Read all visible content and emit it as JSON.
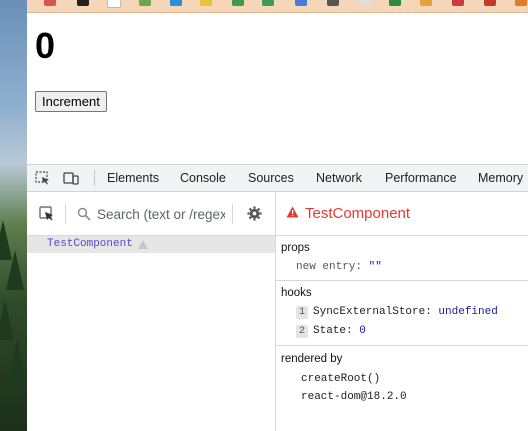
{
  "app": {
    "count": "0",
    "increment_label": "Increment"
  },
  "devtools": {
    "tabs": [
      "Elements",
      "Console",
      "Sources",
      "Network",
      "Performance",
      "Memory"
    ],
    "search": {
      "placeholder": "Search (text or /regex/)"
    },
    "tree": [
      {
        "label": "TestComponent",
        "warning": true
      }
    ],
    "component": {
      "name": "TestComponent",
      "props_title": "props",
      "props": [
        {
          "key": "new entry",
          "value": "\"\""
        }
      ],
      "hooks_title": "hooks",
      "hooks": [
        {
          "index": "1",
          "name": "SyncExternalStore",
          "value": "undefined"
        },
        {
          "index": "2",
          "name": "State",
          "value": "0"
        }
      ],
      "rendered_by_title": "rendered by",
      "rendered_by": [
        "createRoot()",
        "react-dom@18.2.0"
      ]
    }
  },
  "colors": {
    "warning_red": "#e53935",
    "component_purple": "#5b48c8",
    "value_blue": "#1a1aa6",
    "topbar": "#f6d6b9"
  }
}
